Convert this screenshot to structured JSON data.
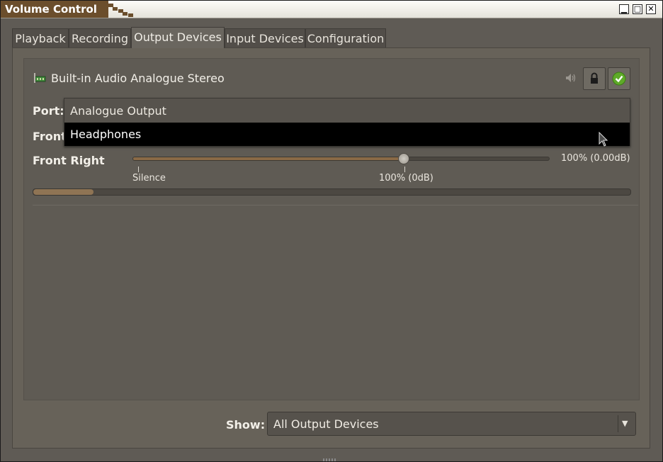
{
  "window": {
    "title": "Volume Control",
    "buttons": {
      "minimize": "▁",
      "maximize": "□",
      "close": "✕"
    }
  },
  "tabs": [
    {
      "label": "Playback",
      "active": false
    },
    {
      "label": "Recording",
      "active": false
    },
    {
      "label": "Output Devices",
      "active": true
    },
    {
      "label": "Input Devices",
      "active": false
    },
    {
      "label": "Configuration",
      "active": false
    }
  ],
  "device": {
    "name": "Built-in Audio Analogue Stereo",
    "icon": "sound-card-icon",
    "controls": {
      "mute_icon": "speaker-icon",
      "lock_icon": "lock-icon",
      "default_icon": "check-icon"
    },
    "port_label": "Port:",
    "port_options": [
      "Analogue Output",
      "Headphones"
    ],
    "port_highlighted": "Headphones",
    "channels": [
      {
        "label": "Front Left",
        "visible_label": "Front"
      },
      {
        "label": "Front Right",
        "visible_label": "Front Right",
        "volume_text": "100% (0.00dB)",
        "volume_fraction": 0.65
      }
    ],
    "scale_marks": {
      "silence": "Silence",
      "zero_db": "100% (0dB)"
    },
    "peak_level_fraction": 0.1
  },
  "show": {
    "label": "Show:",
    "value": "All Output Devices"
  },
  "colors": {
    "accent": "#8a6a46",
    "title_brown": "#6b4e2c",
    "highlight": "#000000"
  }
}
